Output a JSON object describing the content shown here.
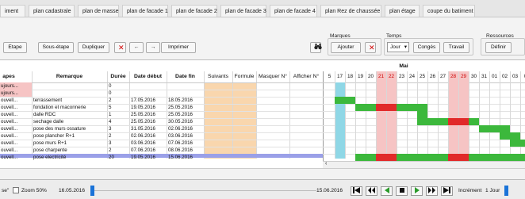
{
  "tabs": [
    "iment",
    "plan cadastrale",
    "plan de masse",
    "plan de facade 1",
    "plan de facade 2",
    "plan de facade 3",
    "plan de facade 4",
    "plan Rez de chaussée",
    "plan étage",
    "coupe du batiment"
  ],
  "toolbar": {
    "etape": "Etape",
    "sous_etape": "Sous-étape",
    "dupliquer": "Dupliquer",
    "delete": "✕",
    "left": "←",
    "right": "→",
    "imprimer": "Imprimer",
    "binoculars": "👀"
  },
  "marques": {
    "title": "Marques",
    "ajouter": "Ajouter",
    "delete": "✕"
  },
  "temps": {
    "title": "Temps",
    "select_value": "Jour",
    "conges": "Congés",
    "travail": "Travail"
  },
  "ressources": {
    "title": "Ressources",
    "definir": "Définir"
  },
  "table": {
    "headers": {
      "etapes": "apes",
      "remarque": "Remarque",
      "duree": "Durée",
      "debut": "Date début",
      "fin": "Date fin",
      "suivants": "Suivants",
      "formule": "Formule",
      "masquer": "Masquer N°",
      "afficher": "Afficher N°"
    },
    "month": "Mai",
    "days": [
      "5",
      "17",
      "18",
      "19",
      "20",
      "21",
      "22",
      "23",
      "24",
      "25",
      "26",
      "27",
      "28",
      "29",
      "30",
      "31",
      "01",
      "02",
      "03",
      "0"
    ],
    "rows": [
      {
        "etape": "ujours...",
        "remarque": "",
        "duree": "0",
        "debut": "",
        "fin": "",
        "pink": true
      },
      {
        "etape": "ujours...",
        "remarque": "",
        "duree": "0",
        "debut": "",
        "fin": "",
        "pink": true
      },
      {
        "etape": "ouvell...",
        "remarque": "terrassement",
        "duree": "2",
        "debut": "17.05.2016",
        "fin": "18.05.2016"
      },
      {
        "etape": "ouvell...",
        "remarque": "fondation et maconnerie",
        "duree": "5",
        "debut": "19.05.2016",
        "fin": "25.05.2016"
      },
      {
        "etape": "ouvell...",
        "remarque": "dalle RDC",
        "duree": "1",
        "debut": "25.05.2016",
        "fin": "25.05.2016"
      },
      {
        "etape": "ouvell...",
        "remarque": "sechage dalle",
        "duree": "4",
        "debut": "25.05.2016",
        "fin": "30.05.2016"
      },
      {
        "etape": "ouvell...",
        "remarque": "pose des murs ossature",
        "duree": "3",
        "debut": "31.05.2016",
        "fin": "02.06.2016"
      },
      {
        "etape": "ouvell...",
        "remarque": "pose plancher R+1",
        "duree": "2",
        "debut": "02.06.2016",
        "fin": "03.06.2016"
      },
      {
        "etape": "ouvell...",
        "remarque": "pose murs R+1",
        "duree": "3",
        "debut": "03.06.2016",
        "fin": "07.06.2016"
      },
      {
        "etape": "ouvell...",
        "remarque": "pose charpente",
        "duree": "2",
        "debut": "07.06.2016",
        "fin": "08.06.2016"
      },
      {
        "etape": "ouvell...",
        "remarque": "pose electricité",
        "duree": "20",
        "debut": "19.05.2016",
        "fin": "15.06.2016"
      }
    ]
  },
  "bottom": {
    "left_text": "se\"",
    "zoom_label": "Zoom 50%",
    "start_date": "16.05.2016",
    "end_date": "15.06.2016",
    "increment_label": "Incrément",
    "increment_value": "1 Jour"
  },
  "colors": {
    "green": "#3cb83c",
    "red": "#e12a2a",
    "pink": "#f6c4c4",
    "cyan": "#8fd7e6",
    "orange": "#f9d6ad",
    "blue": "#1a73d8"
  }
}
